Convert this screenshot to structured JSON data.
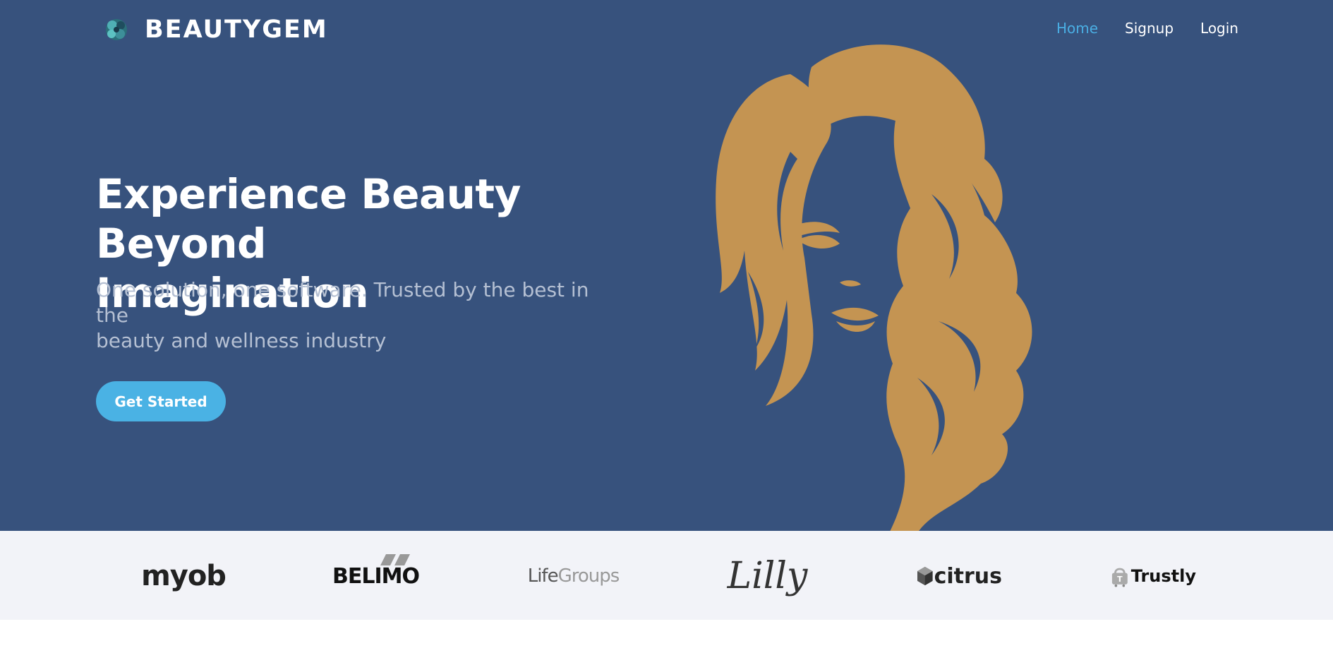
{
  "brand": {
    "name": "BEAUTYGEM"
  },
  "nav": {
    "home": "Home",
    "signup": "Signup",
    "login": "Login"
  },
  "hero": {
    "headline_line1": "Experience Beauty Beyond",
    "headline_line2": "Imagination",
    "subhead_line1": "One solution, one software. Trusted by the best in the",
    "subhead_line2": "beauty and wellness industry",
    "cta": "Get Started"
  },
  "logos": {
    "myob": "myob",
    "belimo": "BELIMO",
    "lifegroups_a": "Life",
    "lifegroups_b": "Groups",
    "lilly": "Lilly",
    "citrus": "citrus",
    "trustly": "Trustly"
  },
  "colors": {
    "hero_bg": "#37527d",
    "accent": "#4ab2e4",
    "hair": "#c49452",
    "strip_bg": "#f2f3f8"
  }
}
